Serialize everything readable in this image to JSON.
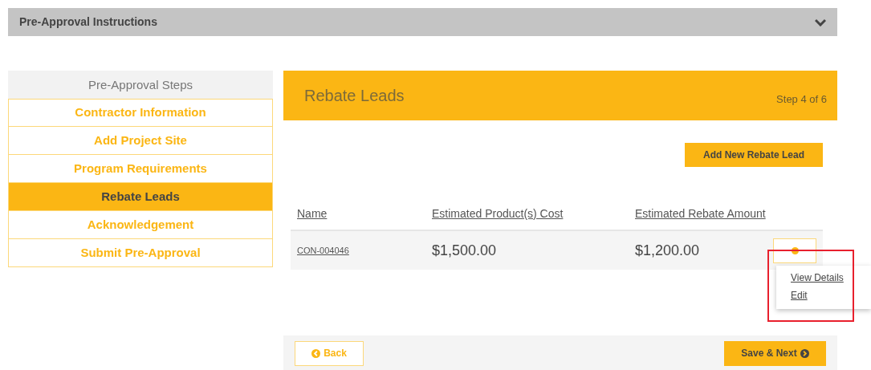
{
  "instructions_panel": {
    "title": "Pre-Approval Instructions",
    "expanded": false
  },
  "steps": {
    "title": "Pre-Approval Steps",
    "items": [
      {
        "label": "Contractor Information",
        "selected": false
      },
      {
        "label": "Add Project Site",
        "selected": false
      },
      {
        "label": "Program Requirements",
        "selected": false
      },
      {
        "label": "Rebate Leads",
        "selected": true
      },
      {
        "label": "Acknowledgement",
        "selected": false
      },
      {
        "label": "Submit Pre-Approval",
        "selected": false
      }
    ]
  },
  "page_header": {
    "title": "Rebate Leads",
    "step": "Step 4 of 6"
  },
  "add_button": "Add New Rebate Lead",
  "table": {
    "columns": [
      "Name",
      "Estimated Product(s) Cost",
      "Estimated Rebate Amount"
    ],
    "rows": [
      {
        "name": "CON-004046",
        "cost": "$1,500.00",
        "rebate": "$1,200.00",
        "menu_open": true,
        "menu_items": [
          "View Details",
          "Edit"
        ]
      }
    ]
  },
  "footer": {
    "back": "Back",
    "next": "Save & Next"
  }
}
